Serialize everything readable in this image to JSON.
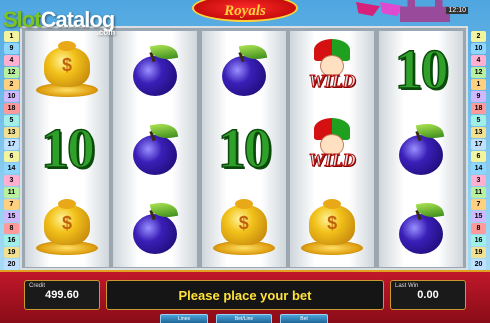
{
  "game": {
    "title": "Royals",
    "clock": "12:10"
  },
  "watermark": {
    "slot": "Slot",
    "catalog": "Catalog",
    "com": ".com"
  },
  "paylines": {
    "left": [
      "1",
      "9",
      "4",
      "12",
      "2",
      "10",
      "18",
      "5",
      "13",
      "17",
      "6",
      "14",
      "3",
      "11",
      "7",
      "15",
      "8",
      "16",
      "19",
      "20"
    ],
    "right": [
      "2",
      "10",
      "4",
      "12",
      "1",
      "9",
      "18",
      "5",
      "13",
      "17",
      "6",
      "14",
      "3",
      "11",
      "7",
      "15",
      "8",
      "16",
      "19",
      "20"
    ],
    "colors": [
      "#f4f4a0",
      "#8fd6ff",
      "#ffb0d0",
      "#b8f0a0",
      "#ffd080",
      "#d0b8ff",
      "#ff9a9a",
      "#a0f0e8",
      "#f0e090",
      "#c0e0ff"
    ]
  },
  "reels": [
    [
      "gold",
      "ten",
      "gold"
    ],
    [
      "plum",
      "plum",
      "plum"
    ],
    [
      "plum",
      "ten",
      "gold"
    ],
    [
      "wild",
      "wild",
      "gold"
    ],
    [
      "ten",
      "plum",
      "plum"
    ]
  ],
  "symbols": {
    "ten_text": "10",
    "wild_text": "WILD",
    "gold_mark": "$"
  },
  "panel": {
    "credit_label": "Credit",
    "credit_value": "499.60",
    "message": "Please place your bet",
    "lastwin_label": "Last Win",
    "lastwin_value": "0.00",
    "buttons": [
      "Lines",
      "Bet/Line",
      "Bet"
    ]
  },
  "colors": {
    "panel_red": "#c0182a",
    "message_yellow": "#ffe23a",
    "ten_green": "#2fa02a",
    "plum_purple": "#3a1fb8"
  }
}
